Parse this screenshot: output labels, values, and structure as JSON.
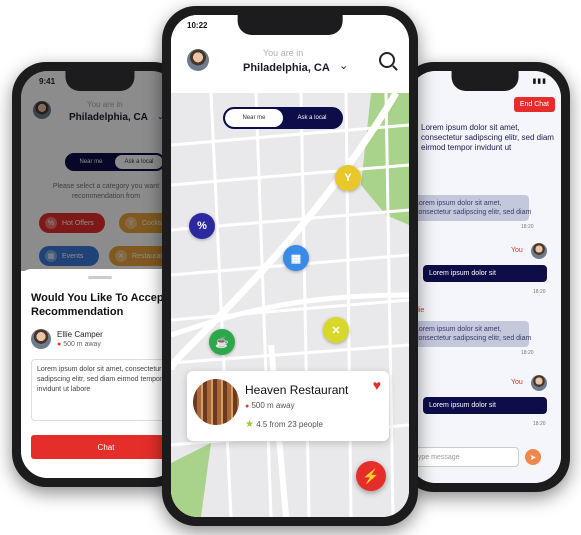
{
  "left_phone": {
    "status_time": "9:41",
    "location_label": "You are in",
    "location": "Philadelphia, CA",
    "toggle": {
      "near_me": "Near me",
      "ask_local": "Ask a local"
    },
    "category_prompt_line1": "Please select a category you want",
    "category_prompt_line2": "recommendation from",
    "categories": [
      {
        "label": "Hot Offers",
        "color": "#e52e2a"
      },
      {
        "label": "Cocktails",
        "color": "#e8a23a"
      },
      {
        "label": "Events",
        "color": "#3a7ad8"
      },
      {
        "label": "Restaurants",
        "color": "#e8a23a"
      }
    ],
    "sheet_title": "Would You Like To Accept Recommendation",
    "user": {
      "name": "Ellie Camper",
      "distance": "500 m away"
    },
    "message": "Lorem ipsum dolor sit amet, consectetur sadipscing elitr, sed diam eirmod tempor invidunt ut labore",
    "chat_button": "Chat"
  },
  "center_phone": {
    "status_time": "10:22",
    "location_label": "You are in",
    "location": "Philadelphia, CA",
    "toggle": {
      "near_me": "Near me",
      "ask_local": "Ask a local"
    },
    "card": {
      "name": "Heaven Restaurant",
      "distance": "500 m away",
      "rating": "4.5 from 23 people"
    },
    "markers": [
      {
        "name": "cocktail",
        "color": "#e8c82a",
        "glyph": "Y"
      },
      {
        "name": "offer",
        "color": "#2a2a9e",
        "glyph": "%"
      },
      {
        "name": "event",
        "color": "#3a8ae8",
        "glyph": "▦"
      },
      {
        "name": "cafe",
        "color": "#2aa84a",
        "glyph": "☕"
      },
      {
        "name": "restaurant",
        "color": "#d8d82a",
        "glyph": "✕"
      }
    ]
  },
  "right_phone": {
    "end_chat": "End Chat",
    "received_1": [
      "Lorem ipsum dolor sit amet,",
      "consectetur sadipscing elitr, sed diam",
      "eirmod tempor invidunt ut"
    ],
    "received_2": [
      "Lorem ipsum dolor sit amet,",
      "consectetur sadipscing elitr, sed diam"
    ],
    "received_2_time": "18:20",
    "you_1": "You",
    "sent_1": "Lorem ipsum dolor sit",
    "sent_1_time": "18:20",
    "received_3_sender": "Ellie",
    "received_3": [
      "Lorem ipsum dolor sit amet,",
      "consectetur sadipscing elitr, sed diam"
    ],
    "received_3_time": "18:20",
    "you_2": "You",
    "sent_2": "Lorem ipsum dolor sit",
    "sent_2_time": "18:20",
    "composer_placeholder": "Type message"
  }
}
